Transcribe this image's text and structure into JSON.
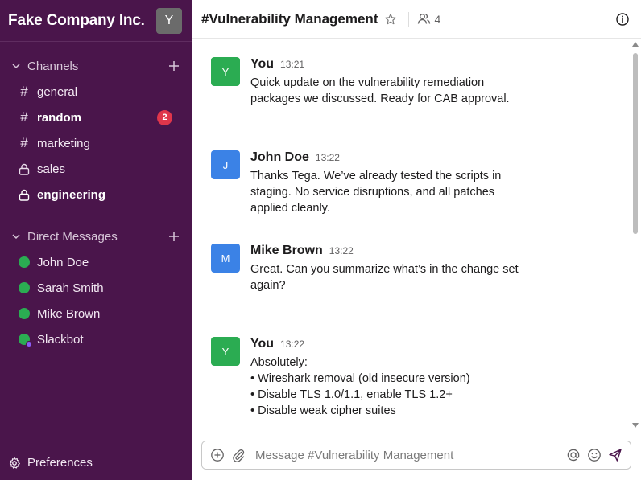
{
  "workspace": {
    "name": "Fake Company Inc.",
    "avatar_initial": "Y"
  },
  "sidebar": {
    "channels_label": "Channels",
    "channels": [
      {
        "name": "general",
        "prefix": "#",
        "bold": false,
        "badge": ""
      },
      {
        "name": "random",
        "prefix": "#",
        "bold": true,
        "badge": "2"
      },
      {
        "name": "marketing",
        "prefix": "#",
        "bold": false,
        "badge": ""
      },
      {
        "name": "sales",
        "prefix": "lock",
        "bold": false,
        "badge": ""
      },
      {
        "name": "engineering",
        "prefix": "lock",
        "bold": true,
        "badge": ""
      }
    ],
    "dms_label": "Direct Messages",
    "dms": [
      {
        "name": "John Doe"
      },
      {
        "name": "Sarah Smith"
      },
      {
        "name": "Mike Brown"
      },
      {
        "name": "Slackbot"
      }
    ],
    "preferences_label": "Preferences"
  },
  "channel": {
    "title": "#Vulnerability Management",
    "member_count": "4"
  },
  "messages": [
    {
      "author": "You",
      "initial": "Y",
      "time": "13:21",
      "color": "#2bac52",
      "lines": [
        "Quick update on the vulnerability remediation",
        "packages we discussed. Ready for CAB approval."
      ]
    },
    {
      "author": "John Doe",
      "initial": "J",
      "time": "13:22",
      "color": "#3b82e6",
      "lines": [
        "Thanks Tega. We’ve already tested the scripts in",
        "staging. No service disruptions, and all patches",
        "applied cleanly."
      ]
    },
    {
      "author": "Mike Brown",
      "initial": "M",
      "time": "13:22",
      "color": "#3b82e6",
      "lines": [
        "Great. Can you summarize what’s in the change set",
        "again?"
      ]
    },
    {
      "author": "You",
      "initial": "Y",
      "time": "13:22",
      "color": "#2bac52",
      "lines": [
        "Absolutely:",
        "• Wireshark removal (old insecure version)",
        "• Disable TLS 1.0/1.1, enable TLS 1.2+",
        "• Disable weak cipher suites"
      ]
    }
  ],
  "composer": {
    "placeholder": "Message #Vulnerability Management"
  }
}
